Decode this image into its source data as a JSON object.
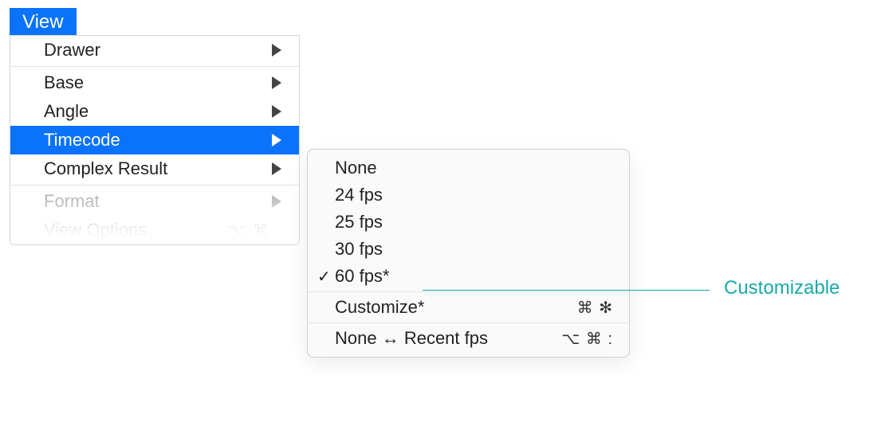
{
  "menubar": {
    "view_label": "View"
  },
  "view_menu": {
    "drawer": "Drawer",
    "base": "Base",
    "angle": "Angle",
    "timecode": "Timecode",
    "complex_result": "Complex Result",
    "format": "Format",
    "view_options": "View Options…",
    "view_options_shortcut": "⌥ ⌘ ,"
  },
  "timecode_submenu": {
    "none": "None",
    "fps24": "24 fps",
    "fps25": "25 fps",
    "fps30": "30 fps",
    "fps60": "60 fps*",
    "customize": "Customize*",
    "customize_shortcut": "⌘ ✻",
    "toggle": "None ↔ Recent fps",
    "toggle_shortcut": "⌥ ⌘ :"
  },
  "annotation": {
    "customizable": "Customizable"
  }
}
